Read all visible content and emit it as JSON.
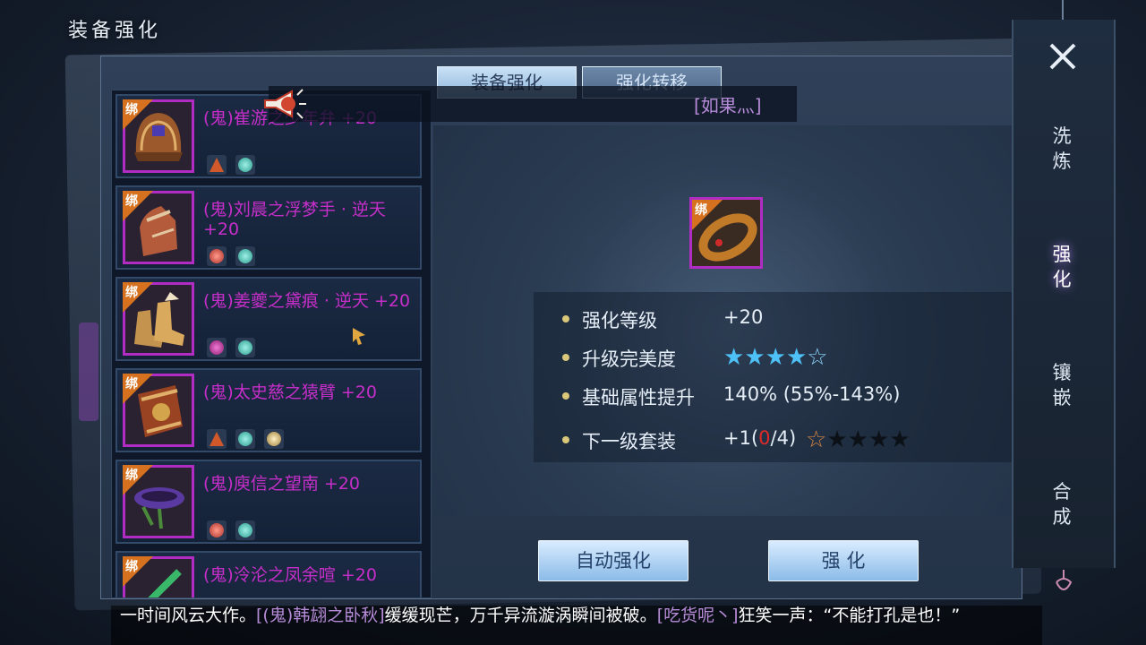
{
  "page": {
    "title": "装备强化"
  },
  "tabs": [
    {
      "label": "装备强化",
      "active": true
    },
    {
      "label": "强化转移",
      "active": false
    }
  ],
  "announcement": {
    "text": "[如果灬]"
  },
  "items": [
    {
      "name": "(鬼)崔游之少年弁 +20",
      "bind": "绑",
      "gems": [
        "fire",
        "teal"
      ]
    },
    {
      "name": "(鬼)刘晨之浮梦手 · 逆天 +20",
      "bind": "绑",
      "gems": [
        "red",
        "teal"
      ]
    },
    {
      "name": "(鬼)姜夔之黛痕 · 逆天 +20",
      "bind": "绑",
      "gems": [
        "purple",
        "teal"
      ]
    },
    {
      "name": "(鬼)太史慈之猿臂 +20",
      "bind": "绑",
      "gems": [
        "fire",
        "teal",
        "gold"
      ]
    },
    {
      "name": "(鬼)庾信之望南 +20",
      "bind": "绑",
      "gems": [
        "red",
        "teal"
      ]
    },
    {
      "name": "(鬼)泠沦之凤余喧 +20",
      "bind": "绑",
      "gems": []
    }
  ],
  "selected": {
    "bind": "绑",
    "icon": "bracelet-icon"
  },
  "stats": {
    "level_label": "强化等级",
    "level_value": "+20",
    "perfection_label": "升级完美度",
    "perfection_stars": 4,
    "perfection_max": 5,
    "base_label": "基础属性提升",
    "base_value": "140% (55%-143%)",
    "set_label": "下一级套装",
    "set_prefix": "+1(",
    "set_current": "0",
    "set_suffix": "/4)",
    "set_stars_filled": 0,
    "set_stars_max": 5
  },
  "buttons": {
    "auto": "自动强化",
    "enhance": "强 化"
  },
  "rail": [
    {
      "label": "洗炼",
      "active": false
    },
    {
      "label": "强化",
      "active": true
    },
    {
      "label": "镶嵌",
      "active": false
    },
    {
      "label": "合成",
      "active": false
    }
  ],
  "chat": {
    "p1": "一时间风云大作。",
    "p2": "[(鬼)韩翃之卧秋]",
    "p3": "缓缓现芒，万千异流漩涡瞬间被破。",
    "p4": "[吃货呢丶]",
    "p5": "狂笑一声：“不能打孔是也！”"
  },
  "colors": {
    "item_name": "#c62ec9",
    "frame": "#b02cc3",
    "bind_tag": "#d6721f",
    "accent_purple": "#b68bd8"
  }
}
